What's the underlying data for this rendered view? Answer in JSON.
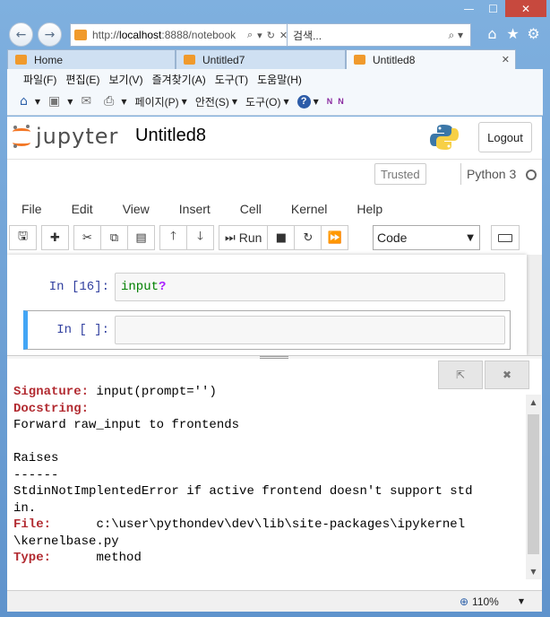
{
  "window": {
    "minimize": "—",
    "maximize": "☐",
    "close": "✕"
  },
  "browser": {
    "address_prefix": "http://",
    "address_host": "localhost",
    "address_rest": ":8888/notebook",
    "search_placeholder": "검색...",
    "tabs": [
      {
        "label": "Home",
        "active": false
      },
      {
        "label": "Untitled7",
        "active": false
      },
      {
        "label": "Untitled8",
        "active": true
      }
    ],
    "menu": [
      "파일(F)",
      "편집(E)",
      "보기(V)",
      "즐겨찾기(A)",
      "도구(T)",
      "도움말(H)"
    ],
    "commands": {
      "page": "페이지(P)",
      "safety": "안전(S)",
      "tools": "도구(O)"
    },
    "zoom": "110%"
  },
  "jupyter": {
    "logo_text": "jupyter",
    "notebook_title": "Untitled8",
    "logout": "Logout",
    "trusted": "Trusted",
    "kernel": "Python 3",
    "menu": [
      "File",
      "Edit",
      "View",
      "Insert",
      "Cell",
      "Kernel",
      "Help"
    ],
    "toolbar": {
      "run_label": "Run",
      "cell_type": "Code"
    },
    "cells": [
      {
        "prompt": "In [16]:",
        "code_name": "input",
        "code_op": "?"
      },
      {
        "prompt": "In [ ]:",
        "code_name": "",
        "code_op": ""
      }
    ],
    "pager": {
      "signature_label": "Signature:",
      "signature_value": "input(prompt='')",
      "docstring_label": "Docstring:",
      "doc_line1": "Forward raw_input to frontends",
      "doc_line2": "Raises",
      "doc_line3": "------",
      "doc_line4": "StdinNotImplentedError if active frontend doesn't support std",
      "doc_line5": "in.",
      "file_label": "File:",
      "file_value1": "c:\\user\\pythondev\\dev\\lib\\site-packages\\ipykernel",
      "file_value2": "\\kernelbase.py",
      "type_label": "Type:",
      "type_value": "method"
    }
  },
  "colors": {
    "accent": "#42a5f5",
    "prompt": "#303f9f",
    "pager_label": "#b22b31",
    "jupyter_orange": "#f37726"
  }
}
